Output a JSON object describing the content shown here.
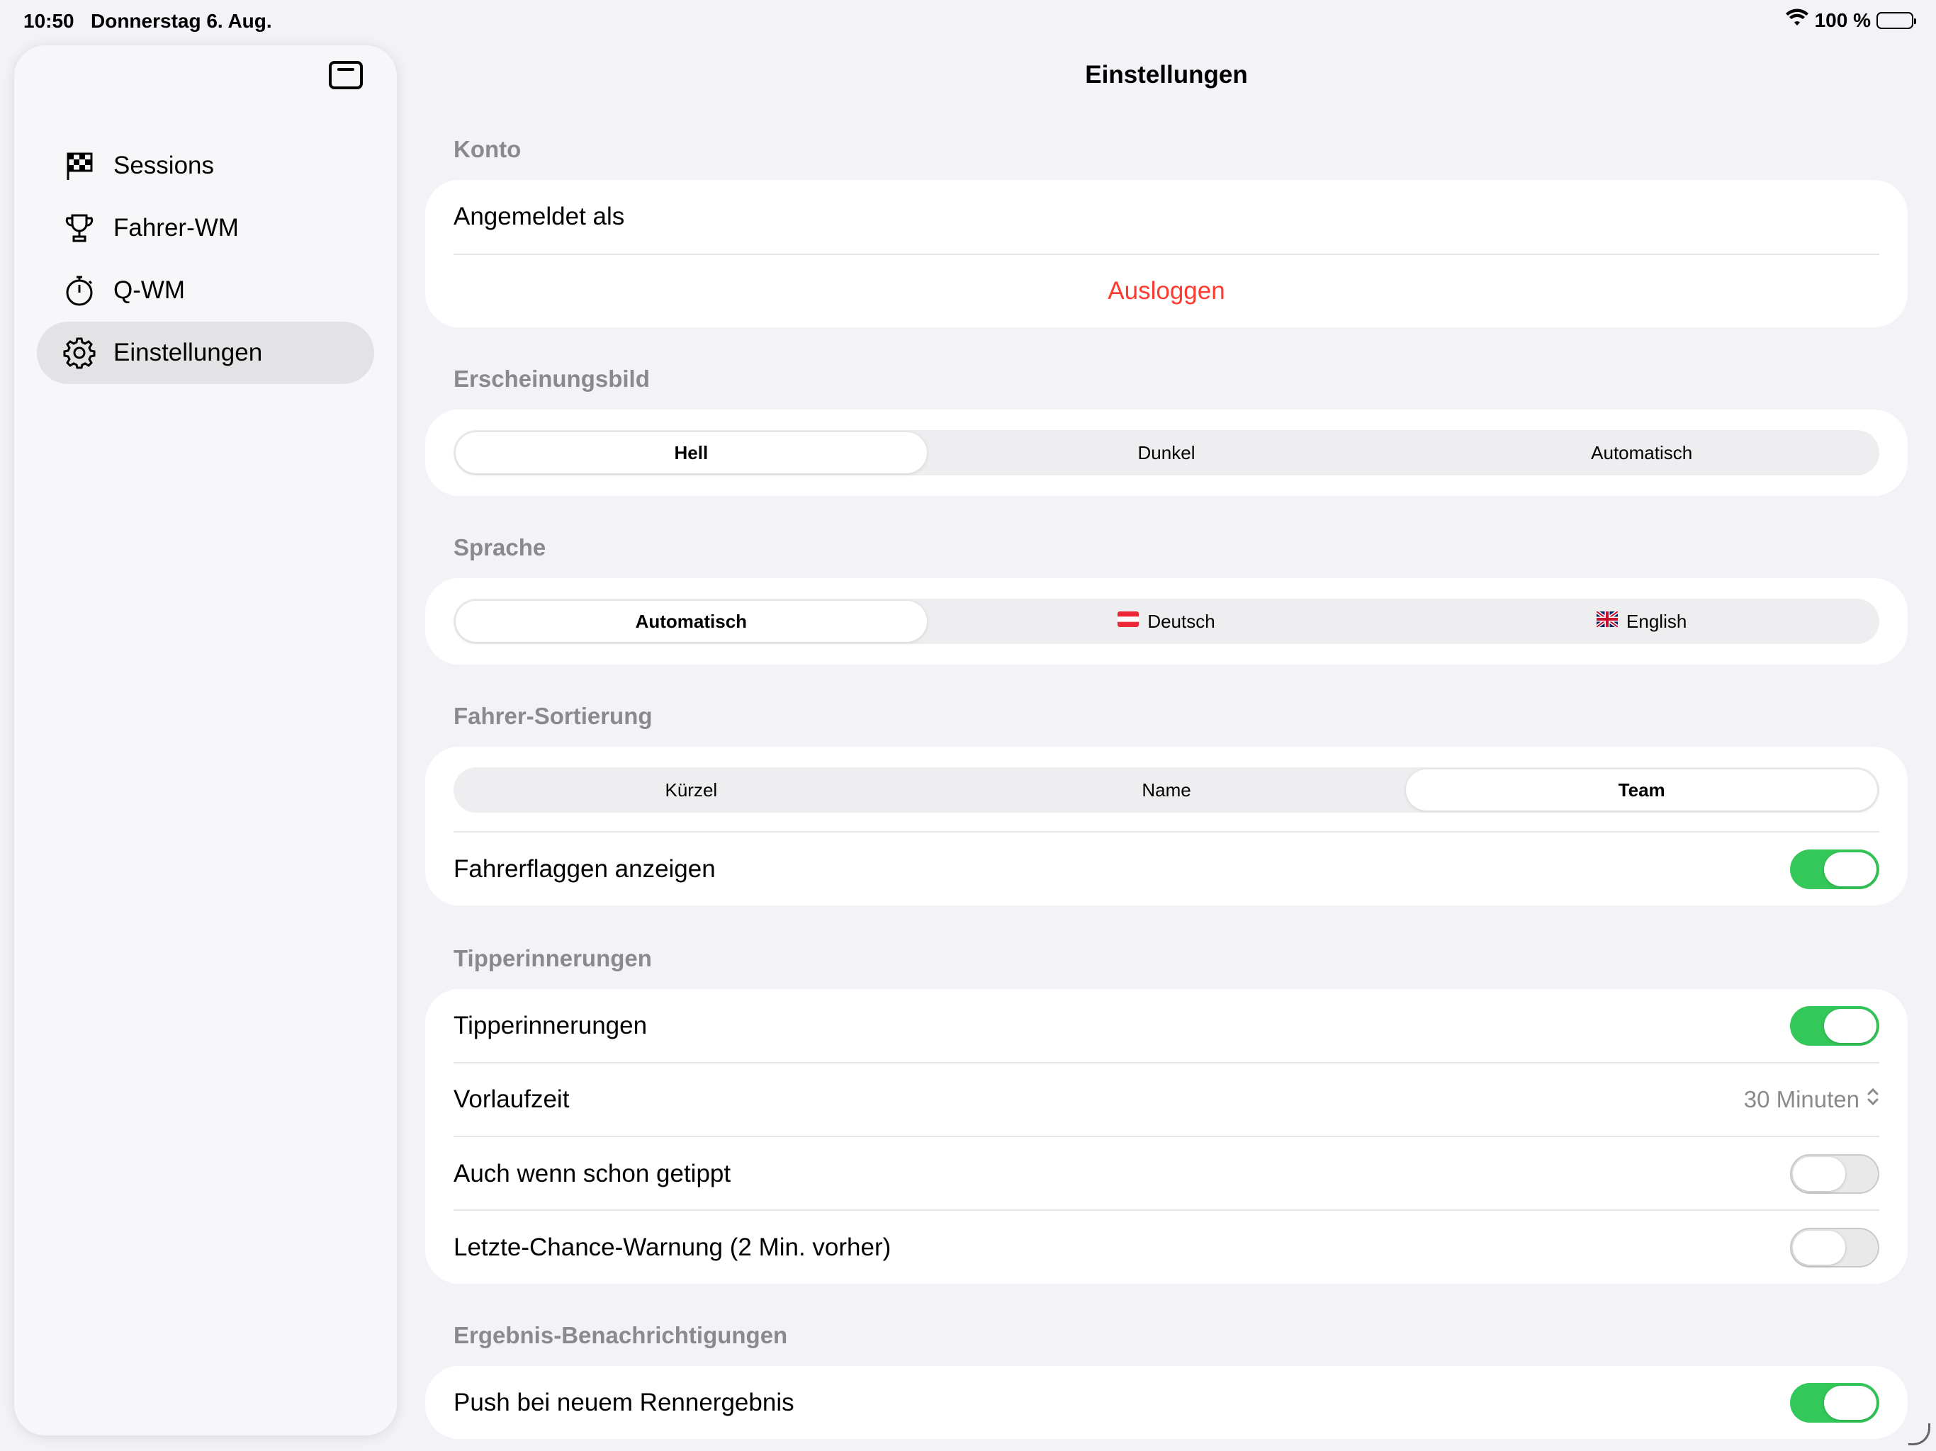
{
  "status_bar": {
    "time": "10:50",
    "date": "Donnerstag 6. Aug.",
    "battery": "100 %"
  },
  "sidebar": {
    "items": [
      {
        "label": "Sessions",
        "icon": "checkered-flag-icon"
      },
      {
        "label": "Fahrer-WM",
        "icon": "trophy-icon"
      },
      {
        "label": "Q-WM",
        "icon": "stopwatch-icon"
      },
      {
        "label": "Einstellungen",
        "icon": "gear-icon",
        "selected": true
      }
    ]
  },
  "main": {
    "title": "Einstellungen",
    "account": {
      "header": "Konto",
      "signed_in_label": "Angemeldet als",
      "logout_label": "Ausloggen"
    },
    "appearance": {
      "header": "Erscheinungsbild",
      "options": [
        "Hell",
        "Dunkel",
        "Automatisch"
      ],
      "selected": "Hell"
    },
    "language": {
      "header": "Sprache",
      "options": [
        "Automatisch",
        "Deutsch",
        "English"
      ],
      "selected": "Automatisch"
    },
    "driver_sort": {
      "header": "Fahrer-Sortierung",
      "options": [
        "Kürzel",
        "Name",
        "Team"
      ],
      "selected": "Team",
      "show_flags_label": "Fahrerflaggen anzeigen",
      "show_flags_on": true
    },
    "tip_reminders": {
      "header": "Tipperinnerungen",
      "reminders_label": "Tipperinnerungen",
      "reminders_on": true,
      "lead_time_label": "Vorlaufzeit",
      "lead_time_value": "30 Minuten",
      "even_if_tipped_label": "Auch wenn schon getippt",
      "even_if_tipped_on": false,
      "last_chance_label": "Letzte-Chance-Warnung (2 Min. vorher)",
      "last_chance_on": false
    },
    "result_notifications": {
      "header": "Ergebnis-Benachrichtigungen",
      "push_label": "Push bei neuem Rennergebnis",
      "push_on": true
    }
  },
  "colors": {
    "accent_green": "#34c759",
    "destructive_red": "#ff3b30",
    "background": "#f2f2f7"
  }
}
